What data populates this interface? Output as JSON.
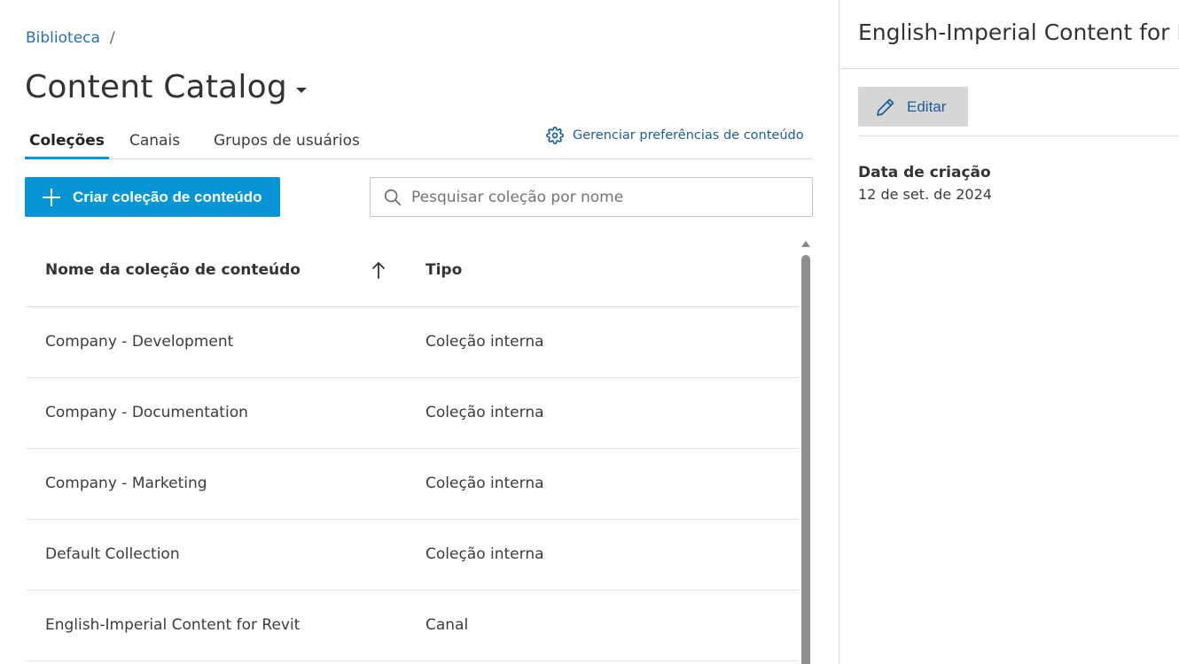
{
  "breadcrumb": {
    "link": "Biblioteca",
    "separator": "/"
  },
  "page": {
    "title": "Content Catalog"
  },
  "tabs": [
    {
      "label": "Coleções",
      "active": true
    },
    {
      "label": "Canais",
      "active": false
    },
    {
      "label": "Grupos de usuários",
      "active": false
    }
  ],
  "prefs_link": {
    "label": "Gerenciar preferências de conteúdo",
    "icon": "gear-icon"
  },
  "toolbar": {
    "create_label": "Criar coleção de conteúdo",
    "search_placeholder": "Pesquisar coleção por nome"
  },
  "table": {
    "columns": {
      "name": "Nome da coleção de conteúdo",
      "type": "Tipo"
    },
    "sort": "ascending",
    "rows": [
      {
        "name": "Company - Development",
        "type": "Coleção interna"
      },
      {
        "name": "Company - Documentation",
        "type": "Coleção interna"
      },
      {
        "name": "Company - Marketing",
        "type": "Coleção interna"
      },
      {
        "name": "Default Collection",
        "type": "Coleção interna"
      },
      {
        "name": "English-Imperial Content for Revit",
        "type": "Canal"
      }
    ]
  },
  "panel": {
    "title": "English-Imperial Content for Revit",
    "edit_label": "Editar",
    "created_label": "Data de criação",
    "created_value": "12 de set. de 2024"
  },
  "colors": {
    "accent": "#0696d7",
    "link": "#1a5e9a",
    "edit_button_bg": "#d6d6d6"
  }
}
